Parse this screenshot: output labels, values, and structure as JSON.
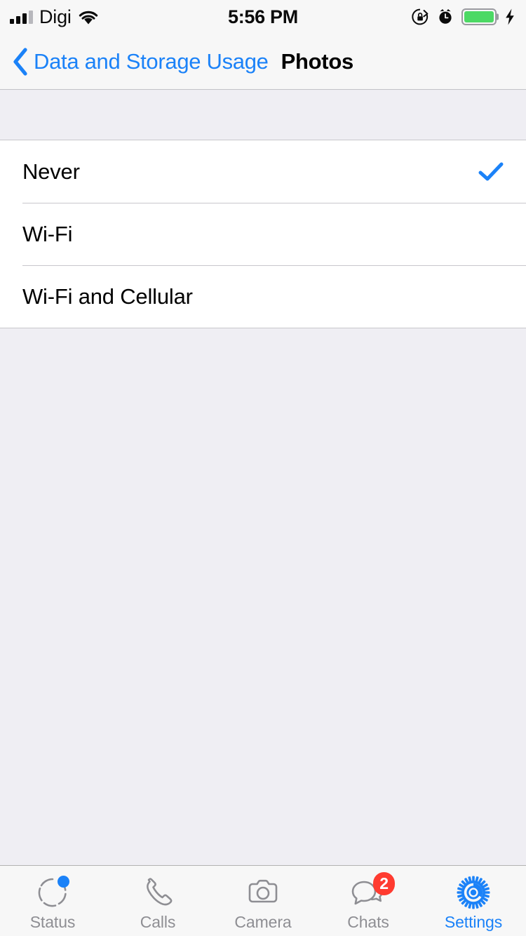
{
  "status_bar": {
    "carrier": "Digi",
    "time": "5:56 PM",
    "signal_bars_filled": 3,
    "signal_bars_total": 4,
    "wifi_icon": "wifi-icon",
    "rotation_lock_icon": "rotation-lock-icon",
    "alarm_icon": "alarm-clock-icon",
    "battery_icon": "battery-icon",
    "battery_color": "#4CD964",
    "charging_icon": "lightning-bolt-icon"
  },
  "nav_bar": {
    "back_icon": "chevron-left-icon",
    "back_label": "Data and Storage Usage",
    "title": "Photos",
    "accent_color": "#1B82F8"
  },
  "options": {
    "rows": [
      {
        "label": "Never",
        "selected": true
      },
      {
        "label": "Wi-Fi",
        "selected": false
      },
      {
        "label": "Wi-Fi and Cellular",
        "selected": false
      }
    ],
    "check_icon": "checkmark-icon",
    "check_color": "#1B82F8"
  },
  "tab_bar": {
    "items": [
      {
        "label": "Status",
        "icon": "status-ring-icon",
        "active": false,
        "dot": true,
        "badge": ""
      },
      {
        "label": "Calls",
        "icon": "phone-icon",
        "active": false,
        "dot": false,
        "badge": ""
      },
      {
        "label": "Camera",
        "icon": "camera-icon",
        "active": false,
        "dot": false,
        "badge": ""
      },
      {
        "label": "Chats",
        "icon": "chat-bubbles-icon",
        "active": false,
        "dot": false,
        "badge": "2"
      },
      {
        "label": "Settings",
        "icon": "gear-icon",
        "active": true,
        "dot": false,
        "badge": ""
      }
    ],
    "inactive_color": "#8E8E93",
    "active_color": "#1B82F8",
    "badge_color": "#FF3B30"
  }
}
